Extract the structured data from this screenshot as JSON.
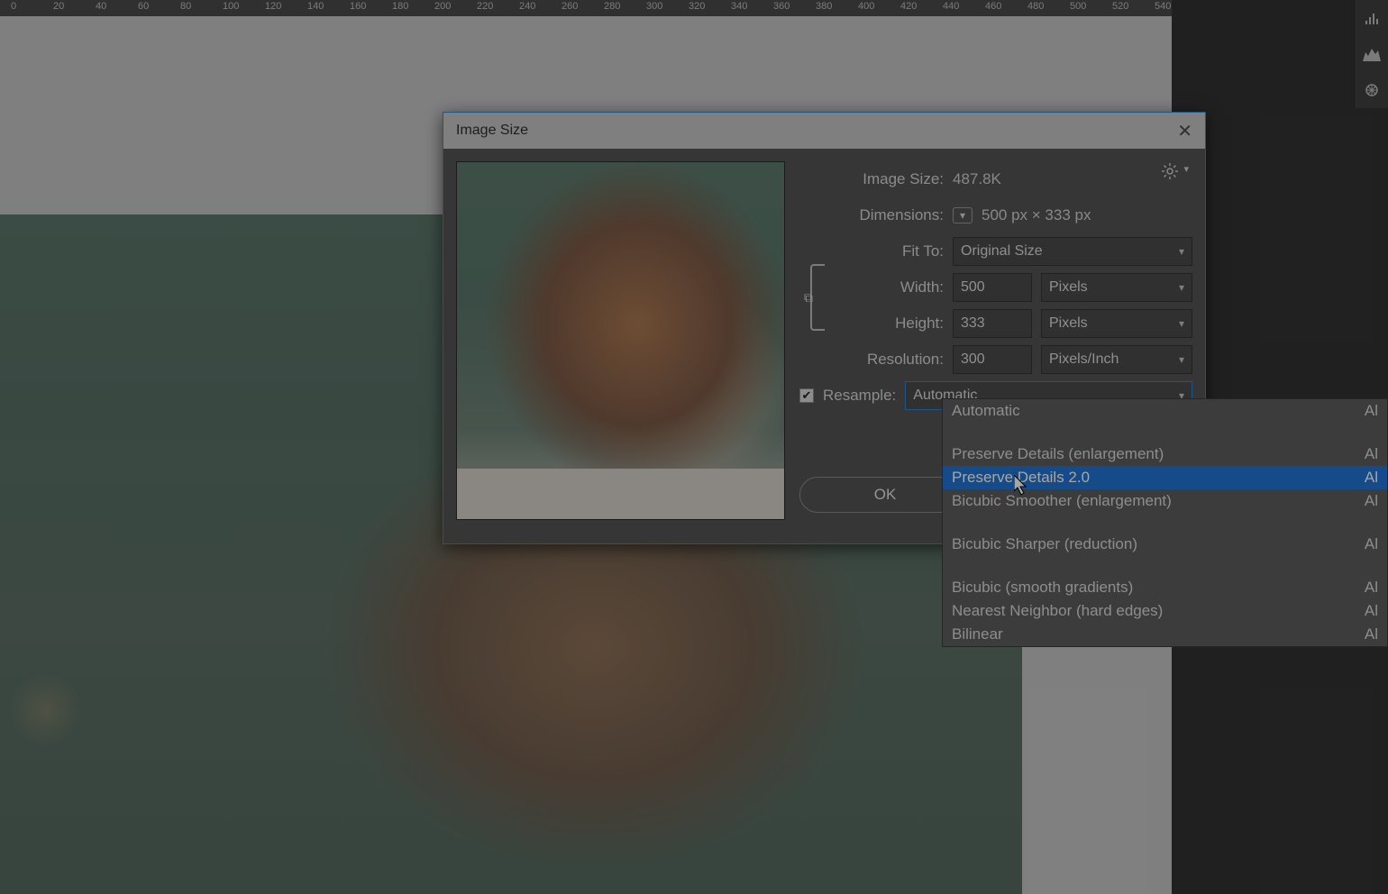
{
  "ruler": {
    "ticks": [
      0,
      20,
      40,
      60,
      80,
      100,
      120,
      140,
      160,
      180,
      200,
      220,
      240,
      260,
      280,
      300,
      320,
      340,
      360,
      380,
      400,
      420,
      440,
      460,
      480,
      500,
      520,
      540
    ]
  },
  "dialog": {
    "title": "Image Size",
    "close": "✕",
    "image_size_label": "Image Size:",
    "image_size_value": "487.8K",
    "dimensions_label": "Dimensions:",
    "dimensions_value": "500 px  ×  333 px",
    "fit_to_label": "Fit To:",
    "fit_to_value": "Original Size",
    "width_label": "Width:",
    "width_value": "500",
    "height_label": "Height:",
    "height_value": "333",
    "resolution_label": "Resolution:",
    "resolution_value": "300",
    "unit_pixels": "Pixels",
    "unit_ppi": "Pixels/Inch",
    "resample_label": "Resample:",
    "resample_value": "Automatic",
    "ok_label": "OK"
  },
  "dropdown": {
    "options": [
      {
        "label": "Automatic",
        "shortcut": "Al"
      },
      {
        "label": "Preserve Details (enlargement)",
        "shortcut": "Al"
      },
      {
        "label": "Preserve Details 2.0",
        "shortcut": "Al",
        "highlight": true
      },
      {
        "label": "Bicubic Smoother (enlargement)",
        "shortcut": "Al"
      },
      {
        "label": "Bicubic Sharper (reduction)",
        "shortcut": "Al"
      },
      {
        "label": "Bicubic (smooth gradients)",
        "shortcut": "Al"
      },
      {
        "label": "Nearest Neighbor (hard edges)",
        "shortcut": "Al"
      },
      {
        "label": "Bilinear",
        "shortcut": "Al"
      }
    ]
  }
}
